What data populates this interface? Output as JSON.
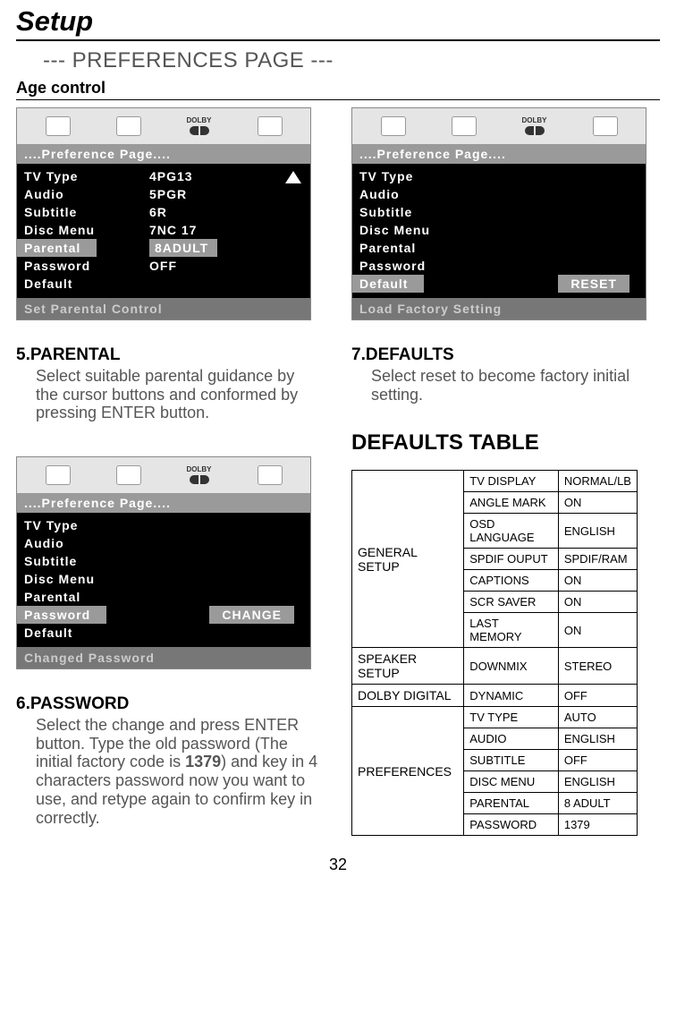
{
  "page": {
    "title": "Setup",
    "subtitle": "--- PREFERENCES PAGE ---",
    "agectrl": "Age control",
    "pagenum": "32"
  },
  "osd_header": "....Preference Page....",
  "dolby": "DOLBY",
  "osd1": {
    "left": [
      "TV Type",
      "Audio",
      "Subtitle",
      "Disc Menu",
      "Parental",
      "Password",
      "Default"
    ],
    "selected_left_idx": 4,
    "right": [
      "4PG13",
      "5PGR",
      "6R",
      "7NC 17",
      "8ADULT",
      "OFF"
    ],
    "selected_right_idx": 4,
    "footer": "Set Parental Control"
  },
  "osd2": {
    "left": [
      "TV Type",
      "Audio",
      "Subtitle",
      "Disc Menu",
      "Parental",
      "Password",
      "Default"
    ],
    "selected_left_idx": 6,
    "action": "RESET",
    "footer": "Load Factory Setting"
  },
  "osd3": {
    "left": [
      "TV Type",
      "Audio",
      "Subtitle",
      "Disc Menu",
      "Parental",
      "Password",
      "Default"
    ],
    "selected_left_idx": 5,
    "action": "CHANGE",
    "footer": "Changed Password"
  },
  "sec5": {
    "h": "5.PARENTAL",
    "b": "Select suitable parental guidance by the cursor buttons and conformed by pressing ENTER button."
  },
  "sec6": {
    "h": "6.PASSWORD",
    "b1": "Select the change and press ENTER button.  Type the old password (The initial factory code is ",
    "bold": "1379",
    "b2": ") and key in 4 characters password now you want to use, and retype again to confirm key in correctly."
  },
  "sec7": {
    "h": "7.DEFAULTS",
    "b": "Select reset to become factory initial setting."
  },
  "defaults_title": "DEFAULTS TABLE",
  "table": {
    "groups": [
      {
        "cat": "GENERAL SETUP",
        "rows": [
          [
            "TV DISPLAY",
            "NORMAL/LB"
          ],
          [
            "ANGLE MARK",
            "ON"
          ],
          [
            "OSD LANGUAGE",
            "ENGLISH"
          ],
          [
            "SPDIF OUPUT",
            "SPDIF/RAM"
          ],
          [
            "CAPTIONS",
            "ON"
          ],
          [
            "SCR SAVER",
            "ON"
          ],
          [
            "LAST MEMORY",
            "ON"
          ]
        ]
      },
      {
        "cat": "SPEAKER SETUP",
        "rows": [
          [
            "DOWNMIX",
            "STEREO"
          ]
        ]
      },
      {
        "cat": "DOLBY DIGITAL",
        "rows": [
          [
            "DYNAMIC",
            "OFF"
          ]
        ]
      },
      {
        "cat": "PREFERENCES",
        "rows": [
          [
            "TV TYPE",
            "AUTO"
          ],
          [
            "AUDIO",
            "ENGLISH"
          ],
          [
            "SUBTITLE",
            "OFF"
          ],
          [
            "DISC MENU",
            "ENGLISH"
          ],
          [
            "PARENTAL",
            "8  ADULT"
          ],
          [
            "PASSWORD",
            "1379"
          ]
        ]
      }
    ]
  }
}
